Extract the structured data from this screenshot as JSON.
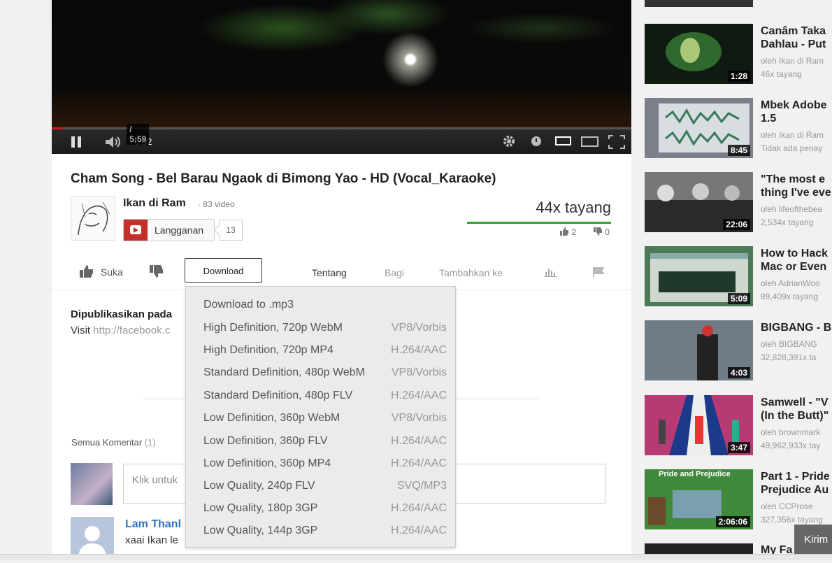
{
  "player": {
    "current_time": "0:02",
    "duration": "/ 5:59",
    "progress_fraction": 0.006
  },
  "video": {
    "title": "Cham Song - Bel Barau Ngaok di Bimong Yao - HD (Vocal_Karaoke)",
    "channel_name": "Ikan di Ram",
    "video_count": "· 83 video",
    "subscribe_label": "Langganan",
    "subscriber_count": "13",
    "views": "44x tayang",
    "likes": "2",
    "dislikes": "0"
  },
  "actions": {
    "like_label": "Suka",
    "download_label": "Download",
    "tabs": [
      {
        "label": "Tentang"
      },
      {
        "label": "Bagi"
      },
      {
        "label": "Tambahkan ke"
      }
    ]
  },
  "description": {
    "published": "Dipublikasikan pada",
    "visit_label": "Visit",
    "visit_link": "http://facebook.c"
  },
  "comments": {
    "header": "Semua Komentar",
    "count": "(1)",
    "input_placeholder": "Klik untuk",
    "items": [
      {
        "author": "Lam Thanl",
        "text": "xaai Ikan le"
      }
    ]
  },
  "download_menu": {
    "header": "Download to .mp3",
    "options": [
      {
        "quality": "High Definition, 720p WebM",
        "format": "VP8/Vorbis"
      },
      {
        "quality": "High Definition, 720p MP4",
        "format": "H.264/AAC"
      },
      {
        "quality": "Standard Definition, 480p WebM",
        "format": "VP8/Vorbis"
      },
      {
        "quality": "Standard Definition, 480p FLV",
        "format": "H.264/AAC"
      },
      {
        "quality": "Low Definition, 360p WebM",
        "format": "VP8/Vorbis"
      },
      {
        "quality": "Low Definition, 360p FLV",
        "format": "H.264/AAC"
      },
      {
        "quality": "Low Definition, 360p MP4",
        "format": "H.264/AAC"
      },
      {
        "quality": "Low Quality, 240p FLV",
        "format": "SVQ/MP3"
      },
      {
        "quality": "Low Quality, 180p 3GP",
        "format": "H.264/AAC"
      },
      {
        "quality": "Low Quality, 144p 3GP",
        "format": "H.264/AAC"
      }
    ]
  },
  "sidebar": {
    "items": [
      {
        "title": "Canâm Taka\nDahlau - Put",
        "meta": "oleh Ikan di Ram\n46x tayang",
        "duration": "1:28",
        "thumb_color": "#2e5a2a"
      },
      {
        "title": "Mbek Adobe\n1.5",
        "meta": "oleh Ikan di Ram\nTidak ada penay",
        "duration": "8:45",
        "thumb_color": "#8a8f95"
      },
      {
        "title": "\"The most e\nthing I've eve",
        "meta": "oleh lifeofthebea\n2,534x tayang",
        "duration": "22:06",
        "thumb_color": "#4a4a4a"
      },
      {
        "title": "How to Hack\nMac or Even",
        "meta": "oleh AdrianWoo\n89,409x tayang",
        "duration": "5:09",
        "thumb_color": "#3b6a4a"
      },
      {
        "title": "BIGBANG - B",
        "meta": "oleh BIGBANG\n32,828,391x ta",
        "duration": "4:03",
        "thumb_color": "#5a6672"
      },
      {
        "title": "Samwell - \"V\n(In the Butt)\"",
        "meta": "oleh brownmark\n49,962,933x tay",
        "duration": "3:47",
        "thumb_color": "#b03a6a"
      },
      {
        "title": "Part 1 - Pride\nPrejudice Au",
        "meta": "oleh CCProse\n327,356x tayang",
        "duration": "2:06:06",
        "thumb_color": "#3f8a3a",
        "thumb_text": "Pride and Prejudice"
      },
      {
        "title": "My Fa",
        "meta": "",
        "duration": "",
        "thumb_color": "#222"
      }
    ],
    "send_label": "Kirim"
  }
}
